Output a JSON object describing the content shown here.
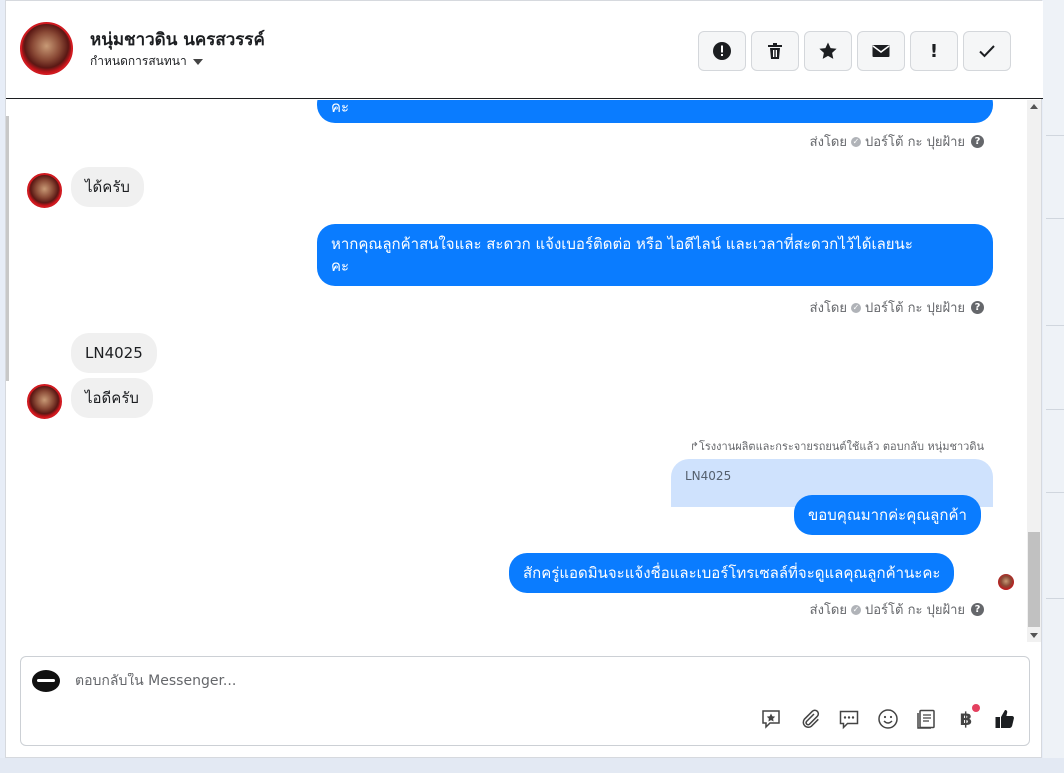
{
  "header": {
    "contact_name": "หนุ่มชาวดิน นครสวรรค์",
    "subtitle": "กำหนดการสนทนา",
    "toolbar": [
      {
        "name": "spam-button",
        "icon": "alert-circle-icon"
      },
      {
        "name": "delete-button",
        "icon": "trash-icon"
      },
      {
        "name": "star-button",
        "icon": "star-icon"
      },
      {
        "name": "mark-unread-button",
        "icon": "envelope-icon"
      },
      {
        "name": "important-button",
        "icon": "exclamation-icon"
      },
      {
        "name": "done-button",
        "icon": "checkmark-icon"
      }
    ]
  },
  "messages": {
    "m1_text": "คะ",
    "sent_by_label": "ส่งโดย",
    "sent_by_name": "ปอร์โต้ กะ ปุยฝ้าย",
    "m2_text": "ได้ครับ",
    "m3_text_line1": "หากคุณลูกค้าสนใจและ สะดวก แจ้งเบอร์ติดต่อ หรือ ไอดีไลน์ และเวลาที่สะดวกไว้ได้เลยนะ",
    "m3_text_line2": "คะ",
    "m4_text": "LN4025",
    "m5_text": "ไอดีครับ",
    "reply_note": "โรงงานผลิตและกระจายรถยนต์ใช้แล้ว ตอบกลับ หนุ่มชาวดิน",
    "reply_quote": "LN4025",
    "m6_text": "ขอบคุณมากค่ะคุณลูกค้า",
    "m7_text": "สักครู่แอดมินจะแจ้งชื่อและเบอร์โทรเซลล์ที่จะดูแลคุณลูกค้านะคะ"
  },
  "composer": {
    "placeholder": "ตอบกลับใน Messenger...",
    "tools": [
      "saved-reply-icon",
      "attachment-icon",
      "chat-bubble-icon",
      "emoji-icon",
      "template-icon",
      "baht-payment-icon",
      "thumbs-up-icon"
    ]
  },
  "colors": {
    "outgoing_bubble": "#0a7cff",
    "incoming_bubble": "#f0f0f0",
    "reply_quote_bg": "#cfe2fd",
    "notification_dot": "#e4405f"
  }
}
